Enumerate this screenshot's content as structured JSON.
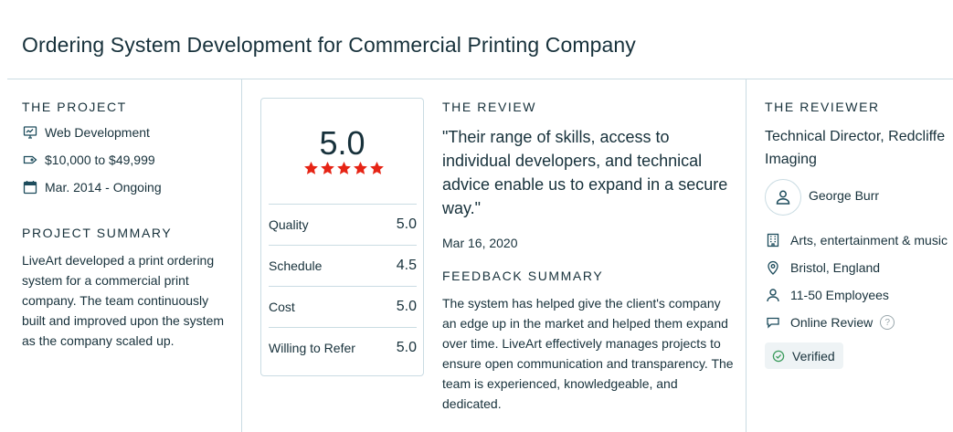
{
  "title": "Ordering System Development for Commercial Printing Company",
  "project": {
    "heading": "THE PROJECT",
    "items": [
      {
        "icon": "monitor-icon",
        "text": "Web Development"
      },
      {
        "icon": "price-tag-icon",
        "text": "$10,000 to $49,999"
      },
      {
        "icon": "calendar-icon",
        "text": "Mar. 2014 - Ongoing"
      }
    ]
  },
  "summary": {
    "heading": "PROJECT SUMMARY",
    "text": "LiveArt developed a print ordering system for a commercial print company. The team continuously built and improved upon the system as the company scaled up."
  },
  "scores": {
    "overall": "5.0",
    "star_rating": 5,
    "star_color": "#e62415",
    "rows": [
      {
        "label": "Quality",
        "value": "5.0"
      },
      {
        "label": "Schedule",
        "value": "4.5"
      },
      {
        "label": "Cost",
        "value": "5.0"
      },
      {
        "label": "Willing to Refer",
        "value": "5.0"
      }
    ]
  },
  "review": {
    "heading": "THE REVIEW",
    "quote": "\"Their range of skills, access to individual developers, and technical advice enable us to expand in a secure way.\"",
    "date": "Mar 16, 2020",
    "feedback_heading": "FEEDBACK SUMMARY",
    "feedback": "The system has helped give the client's company an edge up in the market and helped them expand over time. LiveArt effectively manages projects to ensure open communication and transparency. The team is experienced, knowledgeable, and dedicated."
  },
  "reviewer": {
    "heading": "THE REVIEWER",
    "title": "Technical Director, Redcliffe Imaging",
    "name": "George Burr",
    "details": [
      {
        "icon": "building-icon",
        "text": "Arts, entertainment & music"
      },
      {
        "icon": "location-pin-icon",
        "text": "Bristol, England"
      },
      {
        "icon": "person-icon",
        "text": "11-50 Employees"
      },
      {
        "icon": "chat-bubble-icon",
        "text": "Online Review"
      }
    ],
    "help_glyph": "?",
    "verified": "Verified",
    "verified_color": "#3a9b5c"
  },
  "colors": {
    "text": "#17313b",
    "icon": "#1d4c5c",
    "divider": "#cadce3",
    "star": "#e62415"
  }
}
